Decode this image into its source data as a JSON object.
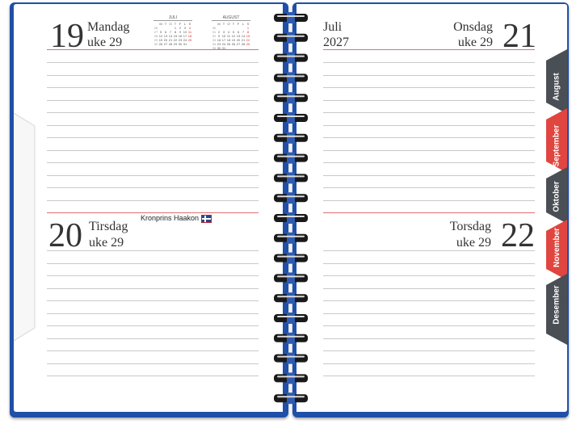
{
  "left_page": {
    "top_day": {
      "number": "19",
      "weekday": "Mandag",
      "week": "uke 29"
    },
    "bottom_day": {
      "number": "20",
      "weekday": "Tirsdag",
      "week": "uke 29",
      "note": "Kronprins Haakon"
    }
  },
  "right_page": {
    "header": {
      "month": "Juli",
      "year": "2027"
    },
    "top_day": {
      "number": "21",
      "weekday": "Onsdag",
      "week": "uke 29"
    },
    "bottom_day": {
      "number": "22",
      "weekday": "Torsdag",
      "week": "uke 29"
    }
  },
  "mini_calendars": [
    {
      "title": "JULI",
      "header": [
        "M",
        "T",
        "O",
        "T",
        "F",
        "L",
        "S"
      ],
      "rows": [
        {
          "wk": "26",
          "days": [
            "",
            "",
            "",
            "1",
            "2",
            "3",
            "4"
          ]
        },
        {
          "wk": "27",
          "days": [
            "5",
            "6",
            "7",
            "8",
            "9",
            "10",
            "11"
          ]
        },
        {
          "wk": "28",
          "days": [
            "12",
            "13",
            "14",
            "15",
            "16",
            "17",
            "18"
          ]
        },
        {
          "wk": "29",
          "days": [
            "19",
            "20",
            "21",
            "22",
            "23",
            "24",
            "25"
          ]
        },
        {
          "wk": "30",
          "days": [
            "26",
            "27",
            "28",
            "29",
            "30",
            "31",
            ""
          ]
        }
      ]
    },
    {
      "title": "AUGUST",
      "header": [
        "M",
        "T",
        "O",
        "T",
        "F",
        "L",
        "S"
      ],
      "rows": [
        {
          "wk": "30",
          "days": [
            "",
            "",
            "",
            "",
            "",
            "",
            "1"
          ]
        },
        {
          "wk": "31",
          "days": [
            "2",
            "3",
            "4",
            "5",
            "6",
            "7",
            "8"
          ]
        },
        {
          "wk": "32",
          "days": [
            "9",
            "10",
            "11",
            "12",
            "13",
            "14",
            "15"
          ]
        },
        {
          "wk": "33",
          "days": [
            "16",
            "17",
            "18",
            "19",
            "20",
            "21",
            "22"
          ]
        },
        {
          "wk": "34",
          "days": [
            "23",
            "24",
            "25",
            "26",
            "27",
            "28",
            "29"
          ]
        },
        {
          "wk": "35",
          "days": [
            "30",
            "31",
            "",
            "",
            "",
            "",
            ""
          ]
        }
      ]
    }
  ],
  "month_tabs": [
    {
      "label": "August",
      "color": "#4a4e55"
    },
    {
      "label": "September",
      "color": "#e0453f"
    },
    {
      "label": "Oktober",
      "color": "#4a4e55"
    },
    {
      "label": "November",
      "color": "#e0453f"
    },
    {
      "label": "Desember",
      "color": "#4a4e55"
    }
  ],
  "colors": {
    "cover": "#1f4fa8",
    "accent_red": "#e0453f",
    "tab_dark": "#4a4e55"
  }
}
